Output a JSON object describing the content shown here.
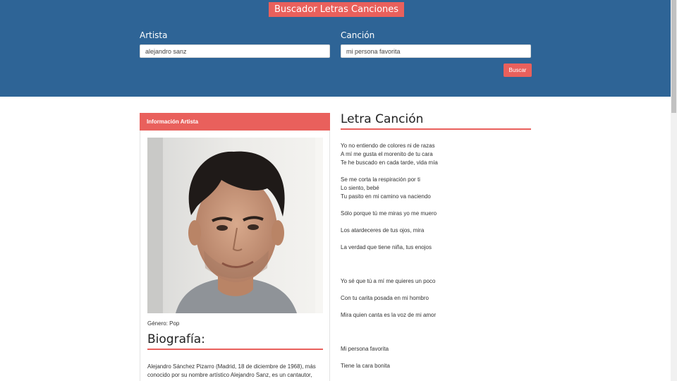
{
  "header": {
    "title": "Buscador Letras Canciones",
    "artist_label": "Artista",
    "artist_value": "alejandro sanz",
    "song_label": "Canción",
    "song_value": "mi persona favorita",
    "search_button": "Buscar"
  },
  "artist": {
    "card_title": "Información Artista",
    "genre": "Género: Pop",
    "bio_title": "Biografía:",
    "bio_text": "Alejandro Sánchez Pizarro (Madrid, 18 de diciembre de 1968), más conocido por su nombre artístico Alejandro Sanz, es un cantautor,"
  },
  "lyrics": {
    "title": "Letra Canción",
    "lines": [
      "Yo no entiendo de colores ni de razas",
      "A mí me gusta el morenito de tu cara",
      "Te he buscado en cada tarde, vida mía",
      "",
      "Se me corta la respiración por ti",
      "Lo siento, bebé",
      "Tu pasito en mi camino va naciendo",
      "",
      "Sólo porque tú me miras yo me muero",
      "",
      "Los atardeceres de tus ojos, mira",
      "",
      "La verdad que tiene niña, tus enojos",
      "",
      "",
      "",
      "Yo sé que tú a mí me quieres un poco",
      "",
      "Con tu carita posada en mi hombro",
      "",
      "Mira quien canta es la voz de mi amor",
      "",
      "",
      "",
      "Mi persona favorita",
      "",
      "Tiene la cara bonita"
    ]
  },
  "colors": {
    "header_bg": "#2e6496",
    "accent": "#e9605c"
  }
}
